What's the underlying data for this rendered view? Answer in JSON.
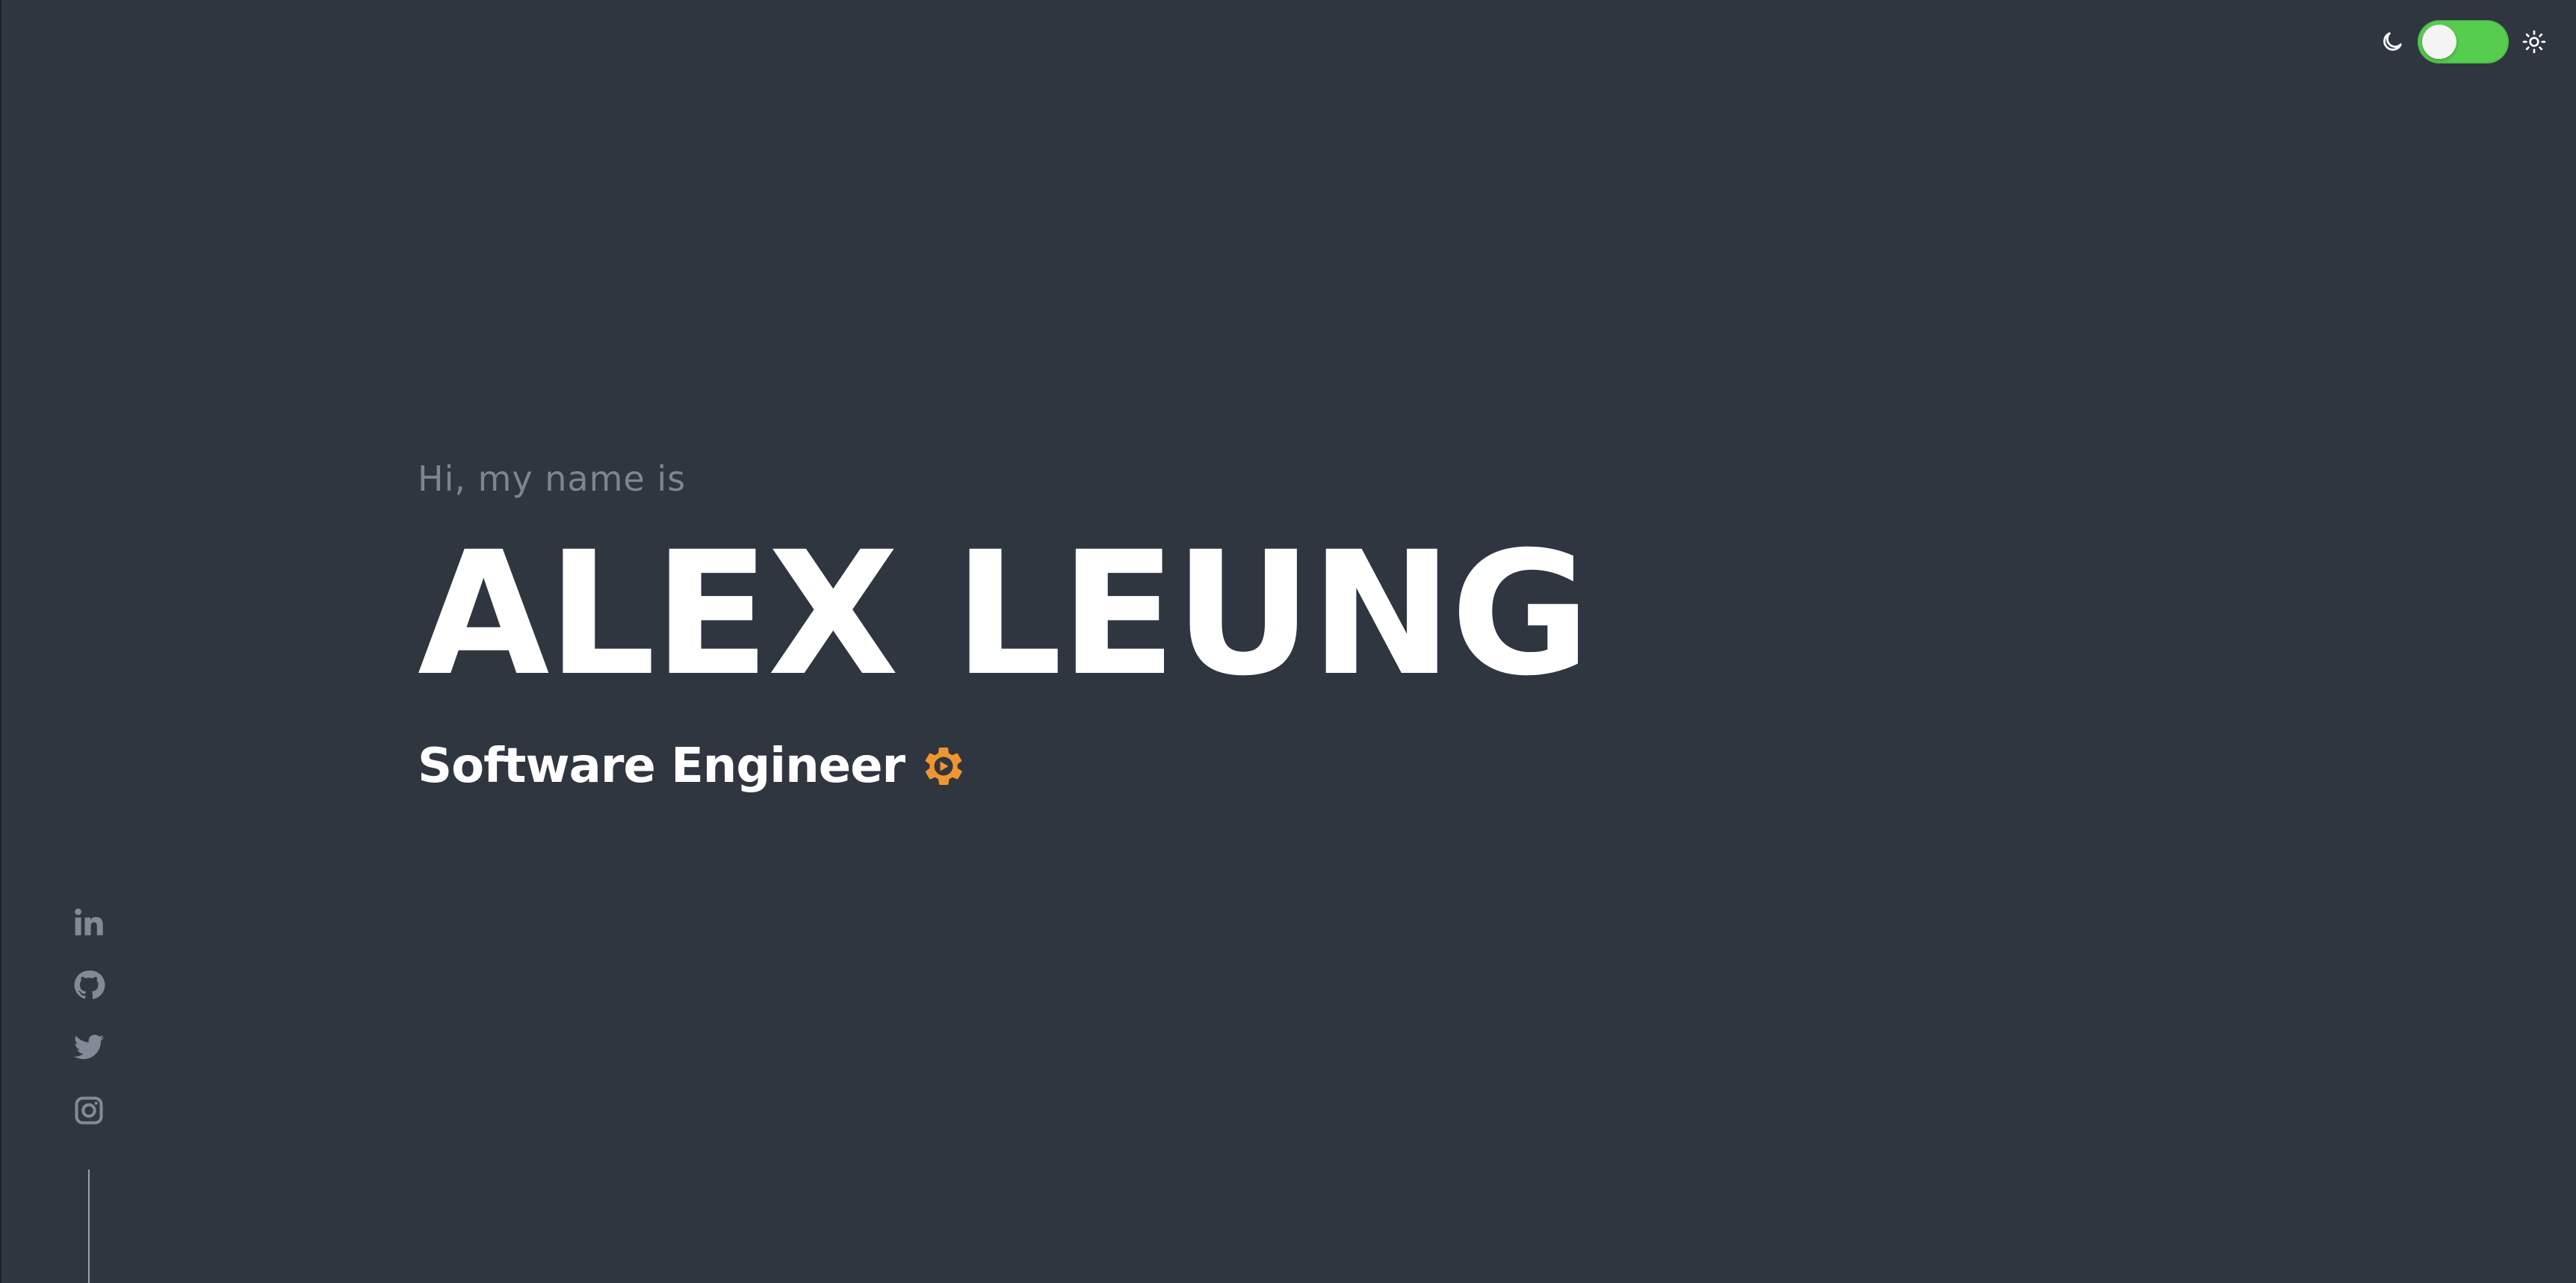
{
  "theme_toggle": {
    "state": "on",
    "accent_color": "#56cd4f",
    "left_icon": "moon-icon",
    "right_icon": "sun-icon"
  },
  "hero": {
    "greeting": "Hi, my name is",
    "name": "ALEX LEUNG",
    "role": "Software Engineer",
    "role_icon": "gear-icon",
    "role_icon_color": "#f0962e"
  },
  "social_links": [
    {
      "icon": "linkedin-icon"
    },
    {
      "icon": "github-icon"
    },
    {
      "icon": "twitter-icon"
    },
    {
      "icon": "instagram-icon"
    }
  ],
  "colors": {
    "background": "#303640",
    "muted_text": "#7d8591",
    "primary_text": "#ffffff"
  }
}
